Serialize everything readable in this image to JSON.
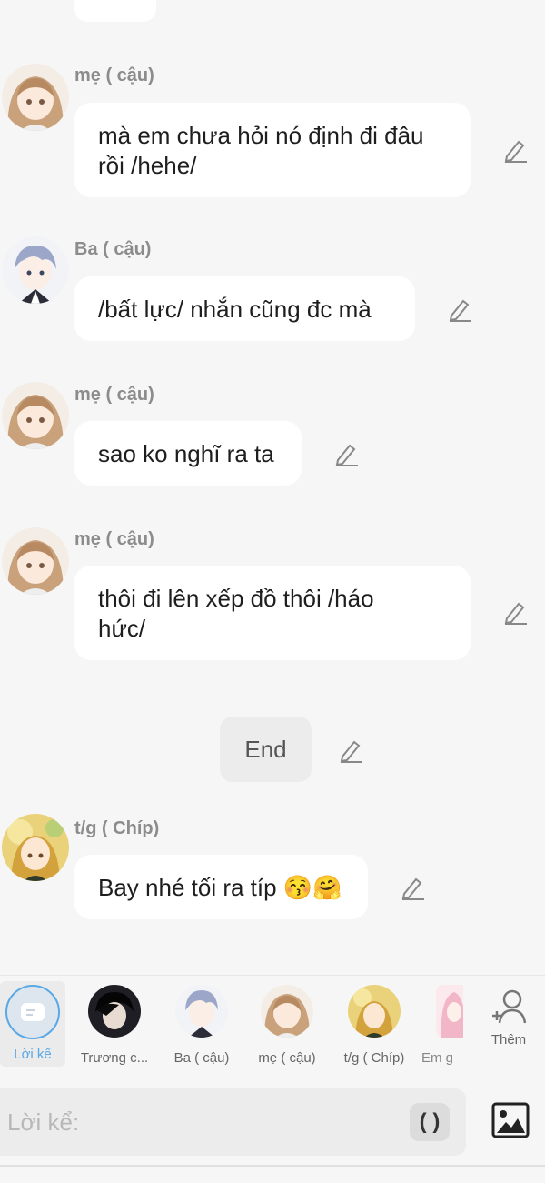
{
  "messages": [
    {
      "name": "mẹ ( cậu)",
      "lines": [
        "mà em chưa hỏi nó định đi đâu",
        "rồi /hehe/"
      ]
    },
    {
      "name": "Ba ( cậu)",
      "lines": [
        "/bất lực/ nhắn cũng đc mà"
      ]
    },
    {
      "name": "mẹ ( cậu)",
      "lines": [
        "sao ko nghĩ ra ta"
      ]
    },
    {
      "name": "mẹ ( cậu)",
      "lines": [
        "thôi đi lên xếp đồ thôi /háo",
        "hức/"
      ]
    },
    {
      "name": "t/g ( Chíp)",
      "lines": [
        "Bay nhé tối ra típ 😚🤗"
      ]
    }
  ],
  "narration": {
    "text": "End"
  },
  "characters": [
    {
      "label": "Lời kể",
      "selected": true
    },
    {
      "label": "Trương c..."
    },
    {
      "label": "Ba ( cậu)"
    },
    {
      "label": "mẹ ( cậu)"
    },
    {
      "label": "t/g ( Chíp)"
    },
    {
      "label": "Em g"
    }
  ],
  "add_button": {
    "label": "Thêm"
  },
  "composer": {
    "placeholder": "Lời kể:",
    "paren_button": "( )"
  },
  "colors": {
    "accent": "#5aa8e6",
    "background": "#f6f6f6",
    "bubble": "#ffffff"
  }
}
